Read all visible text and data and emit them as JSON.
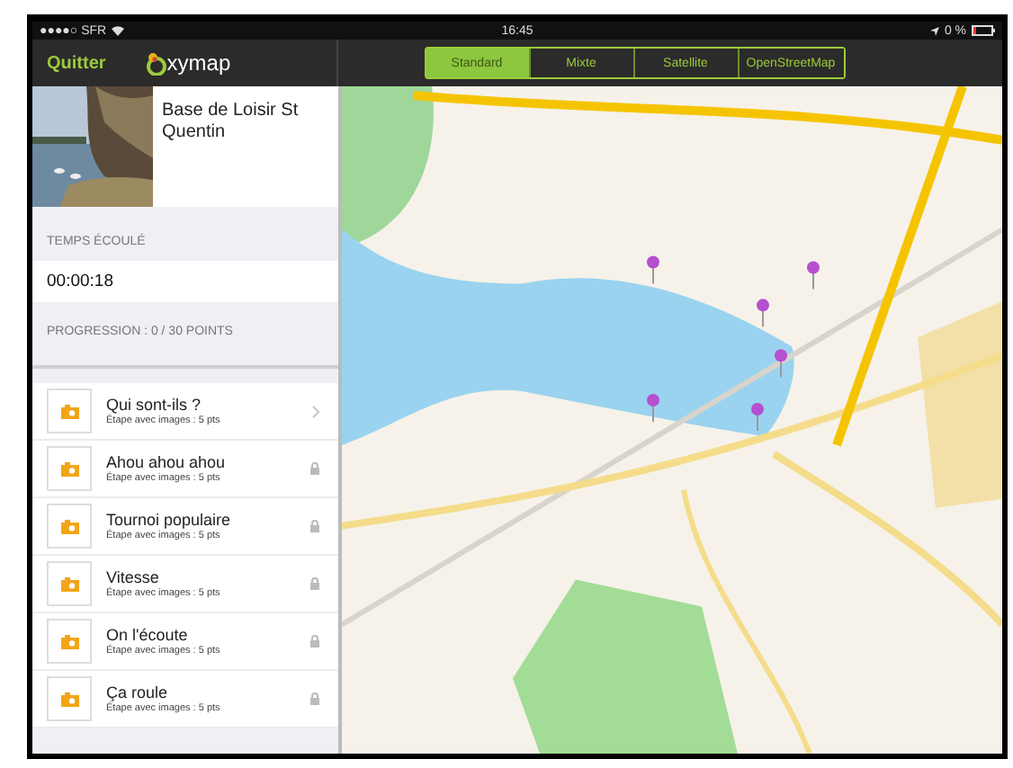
{
  "status_bar": {
    "carrier": "●●●●○ SFR",
    "time": "16:45",
    "battery": "0 %"
  },
  "nav": {
    "back": "Quitter",
    "logo": "xymap"
  },
  "map_types": [
    {
      "label": "Standard",
      "selected": true
    },
    {
      "label": "Mixte",
      "selected": false
    },
    {
      "label": "Satellite",
      "selected": false
    },
    {
      "label": "OpenStreetMap",
      "selected": false
    }
  ],
  "course": {
    "title": "Base de Loisir St Quentin"
  },
  "elapsed": {
    "label": "TEMPS ÉCOULÉ",
    "value": "00:00:18"
  },
  "progress": {
    "label": "PROGRESSION : 0 / 30 POINTS"
  },
  "steps": [
    {
      "title": "Qui sont-ils ?",
      "subtitle": "Étape avec images : 5 pts",
      "locked": false
    },
    {
      "title": "Ahou ahou ahou",
      "subtitle": "Étape avec images : 5 pts",
      "locked": true
    },
    {
      "title": "Tournoi populaire",
      "subtitle": "Étape avec images : 5 pts",
      "locked": true
    },
    {
      "title": "Vitesse",
      "subtitle": "Étape avec images : 5 pts",
      "locked": true
    },
    {
      "title": "On l'écoute",
      "subtitle": "Étape avec images : 5 pts",
      "locked": true
    },
    {
      "title": "Ça roule",
      "subtitle": "Étape avec images : 5 pts",
      "locked": true
    }
  ]
}
